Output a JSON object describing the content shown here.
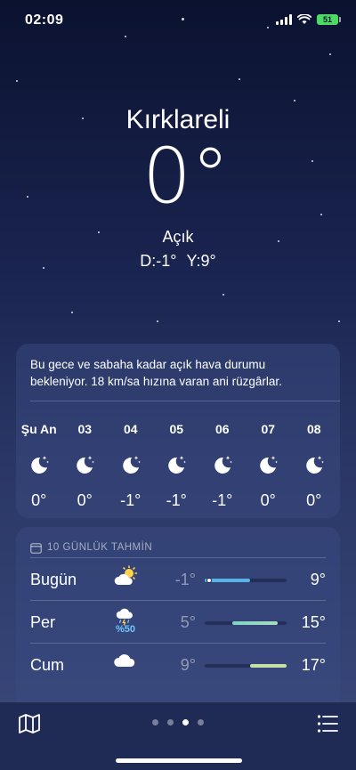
{
  "status": {
    "time": "02:09",
    "battery": "51"
  },
  "location": {
    "city": "Kırklareli",
    "temp": "0°",
    "condition": "Açık",
    "low": "D:-1°",
    "high": "Y:9°"
  },
  "hourly": {
    "description": "Bu gece ve sabaha kadar açık hava durumu bekleniyor. 18 km/sa hızına varan ani rüzgârlar.",
    "items": [
      {
        "label": "Şu An",
        "icon": "moon-stars-icon",
        "temp": "0°"
      },
      {
        "label": "03",
        "icon": "moon-stars-icon",
        "temp": "0°"
      },
      {
        "label": "04",
        "icon": "moon-stars-icon",
        "temp": "-1°"
      },
      {
        "label": "05",
        "icon": "moon-stars-icon",
        "temp": "-1°"
      },
      {
        "label": "06",
        "icon": "moon-stars-icon",
        "temp": "-1°"
      },
      {
        "label": "07",
        "icon": "moon-stars-icon",
        "temp": "0°"
      },
      {
        "label": "08",
        "icon": "moon-stars-icon",
        "temp": "0°"
      }
    ]
  },
  "daily": {
    "header": "10 GÜNLÜK TAHMİN",
    "range": {
      "min": -1,
      "max": 17
    },
    "current_temp": 0,
    "days": [
      {
        "day": "Bugün",
        "icon": "sun-behind-cloud-icon",
        "precip": "",
        "low": "-1°",
        "high": "9°",
        "low_val": -1,
        "high_val": 9,
        "color_from": "#5ab3e6",
        "color_to": "#5ab3e6"
      },
      {
        "day": "Per",
        "icon": "cloud-rain-thunder-icon",
        "precip": "%50",
        "low": "5°",
        "high": "15°",
        "low_val": 5,
        "high_val": 15,
        "color_from": "#7ed6c4",
        "color_to": "#a7dcc0"
      },
      {
        "day": "Cum",
        "icon": "cloud-icon",
        "precip": "",
        "low": "9°",
        "high": "17°",
        "low_val": 9,
        "high_val": 17,
        "color_from": "#c5e1a5",
        "color_to": "#c5e1a5"
      }
    ]
  },
  "colors": {
    "accent_precip": "#6ec6ff",
    "battery": "#4cd964"
  }
}
